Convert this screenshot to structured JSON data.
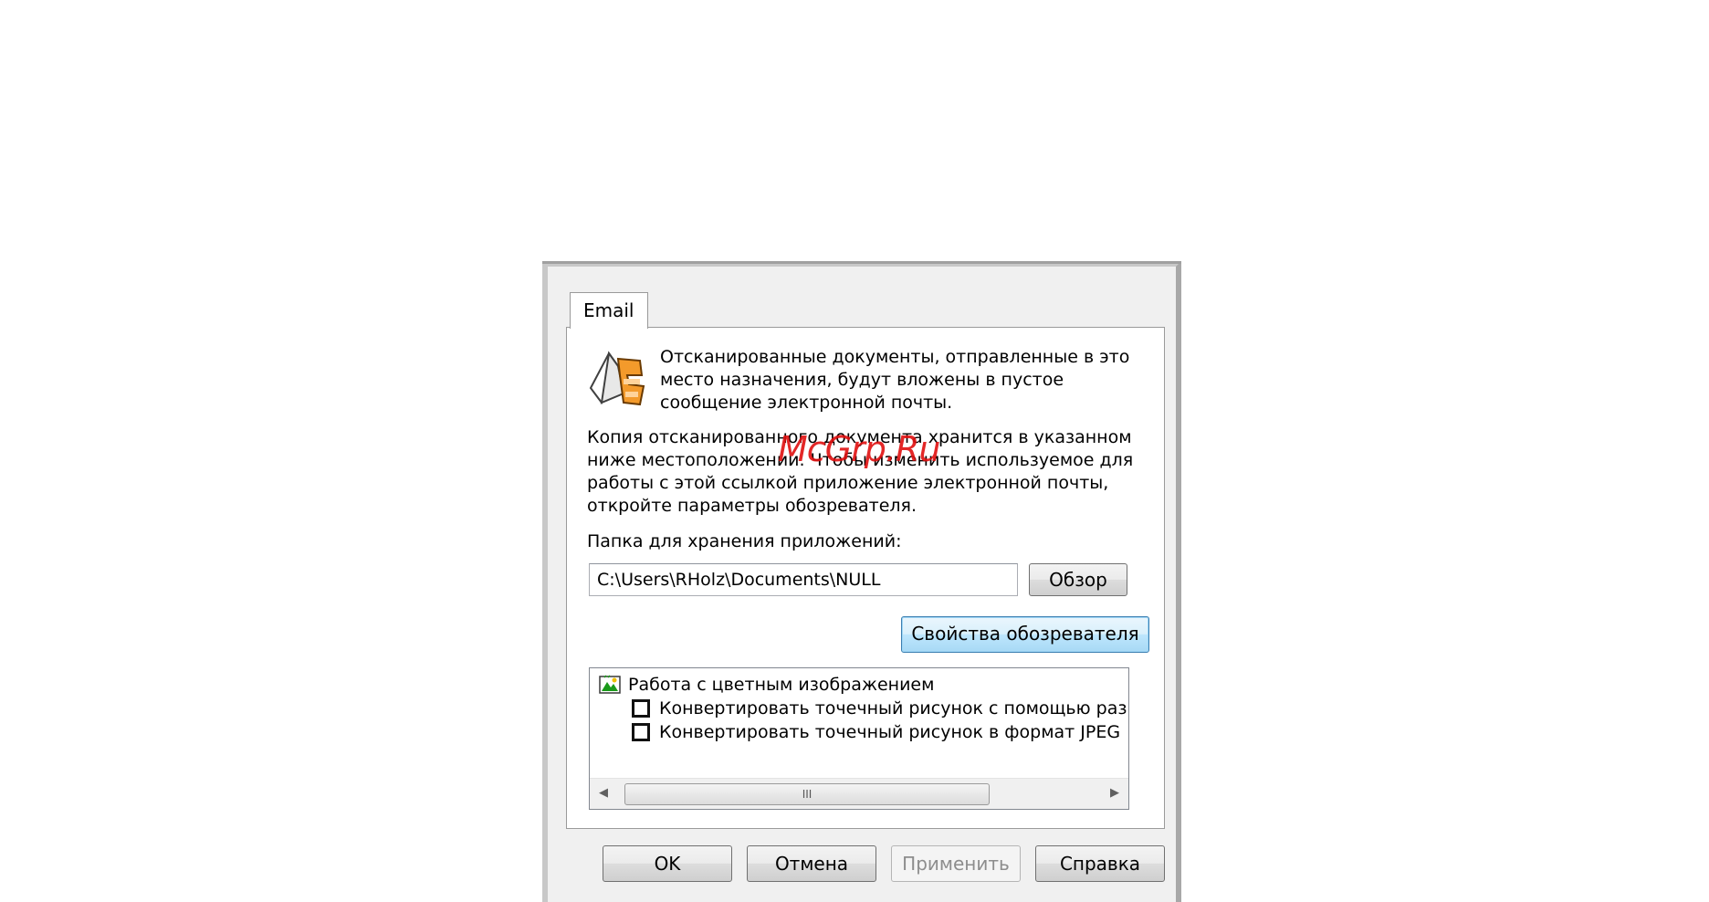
{
  "dialog": {
    "tab_label": "Email",
    "intro_lines": [
      "Отсканированные документы, отправленные в это",
      "место назначения, будут вложены в пустое",
      "сообщение электронной почты."
    ],
    "copy_lines": [
      "Копия отсканированного документа хранится в указанном",
      "ниже местоположении. Чтобы изменить используемое для",
      "работы с этой ссылкой приложение электронной почты,",
      "откройте параметры обозревателя."
    ],
    "folder_label": "Папка для хранения приложений:",
    "folder_path": "C:\\Users\\RHolz\\Documents\\NULL",
    "browse_label": "Обзор",
    "browser_props_label": "Свойства обозревателя",
    "tree": {
      "root_label": "Работа с цветным изображением",
      "items": [
        {
          "label": "Конвертировать точечный рисунок с помощью раз",
          "checked": false
        },
        {
          "label": "Конвертировать точечный рисунок в формат JPEG",
          "checked": false
        }
      ],
      "scroll_thumb_label": "III"
    },
    "buttons": {
      "ok": "OK",
      "cancel": "Отмена",
      "apply": "Применить",
      "help": "Справка"
    }
  },
  "watermark": "McGrp.Ru",
  "colors": {
    "dialog_bg": "#f0f0f0",
    "frame": "#c8c8c8",
    "focus_button": "#3c7fb1",
    "watermark": "#e01010"
  }
}
